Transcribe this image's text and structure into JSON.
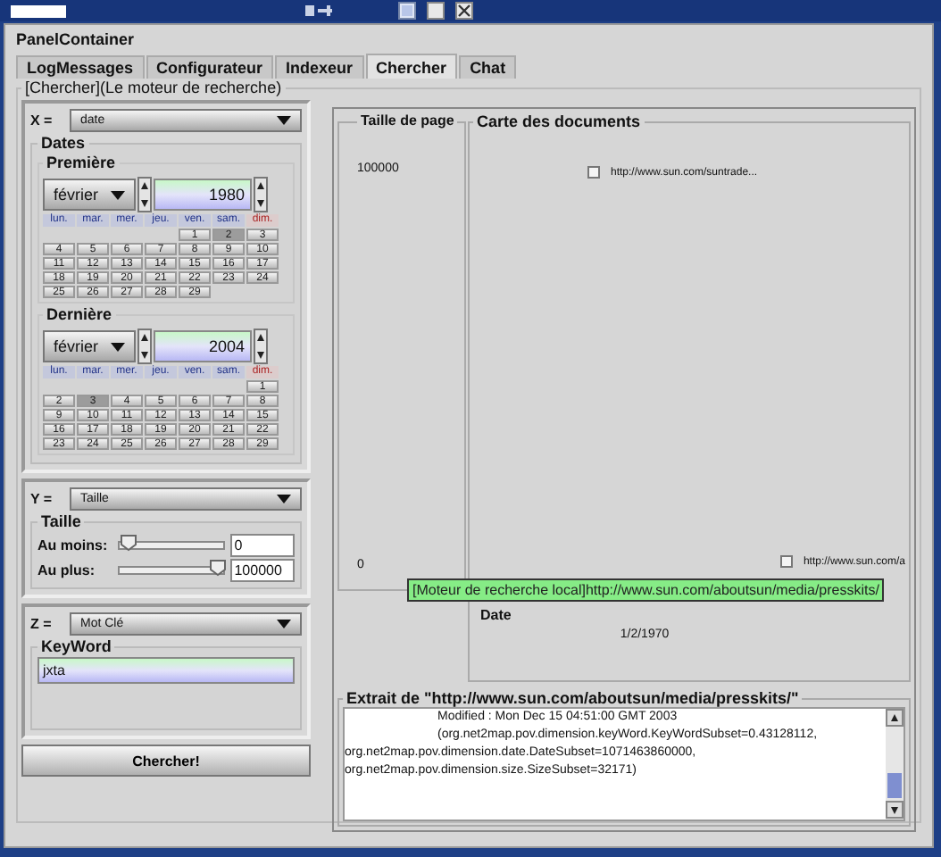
{
  "container_title": "PanelContainer",
  "tabs": [
    {
      "label": "LogMessages",
      "selected": false
    },
    {
      "label": "Configurateur",
      "selected": false
    },
    {
      "label": "Indexeur",
      "selected": false
    },
    {
      "label": "Chercher",
      "selected": true
    },
    {
      "label": "Chat",
      "selected": false
    }
  ],
  "panel_title": "[Chercher](Le moteur de recherche)",
  "x_axis": {
    "label": "X =",
    "value": "date",
    "group": "Dates",
    "calendars": [
      {
        "title": "Première",
        "month": "février",
        "year": "1980",
        "day_headers": [
          "lun.",
          "mar.",
          "mer.",
          "jeu.",
          "ven.",
          "sam.",
          "dim."
        ],
        "weeks": [
          [
            {
              "day": "1",
              "selected": false
            },
            {
              "day": "2",
              "selected": true
            },
            {
              "day": "3",
              "selected": false
            }
          ],
          [
            {
              "day": "4",
              "selected": false
            },
            {
              "day": "5",
              "selected": false
            },
            {
              "day": "6",
              "selected": false
            },
            {
              "day": "7",
              "selected": false
            },
            {
              "day": "8",
              "selected": false
            },
            {
              "day": "9",
              "selected": false
            },
            {
              "day": "10",
              "selected": false
            }
          ],
          [
            {
              "day": "11",
              "selected": false
            },
            {
              "day": "12",
              "selected": false
            },
            {
              "day": "13",
              "selected": false
            },
            {
              "day": "14",
              "selected": false
            },
            {
              "day": "15",
              "selected": false
            },
            {
              "day": "16",
              "selected": false
            },
            {
              "day": "17",
              "selected": false
            }
          ],
          [
            {
              "day": "18",
              "selected": false
            },
            {
              "day": "19",
              "selected": false
            },
            {
              "day": "20",
              "selected": false
            },
            {
              "day": "21",
              "selected": false
            },
            {
              "day": "22",
              "selected": false
            },
            {
              "day": "23",
              "selected": false
            },
            {
              "day": "24",
              "selected": false
            }
          ],
          [
            {
              "day": "25",
              "selected": false
            },
            {
              "day": "26",
              "selected": false
            },
            {
              "day": "27",
              "selected": false
            },
            {
              "day": "28",
              "selected": false
            },
            {
              "day": "29",
              "selected": false
            }
          ]
        ]
      },
      {
        "title": "Dernière",
        "month": "février",
        "year": "2004",
        "day_headers": [
          "lun.",
          "mar.",
          "mer.",
          "jeu.",
          "ven.",
          "sam.",
          "dim."
        ],
        "weeks": [
          [
            {
              "day": "1",
              "selected": false
            }
          ],
          [
            {
              "day": "2",
              "selected": false
            },
            {
              "day": "3",
              "selected": true
            },
            {
              "day": "4",
              "selected": false
            },
            {
              "day": "5",
              "selected": false
            },
            {
              "day": "6",
              "selected": false
            },
            {
              "day": "7",
              "selected": false
            },
            {
              "day": "8",
              "selected": false
            }
          ],
          [
            {
              "day": "9",
              "selected": false
            },
            {
              "day": "10",
              "selected": false
            },
            {
              "day": "11",
              "selected": false
            },
            {
              "day": "12",
              "selected": false
            },
            {
              "day": "13",
              "selected": false
            },
            {
              "day": "14",
              "selected": false
            },
            {
              "day": "15",
              "selected": false
            }
          ],
          [
            {
              "day": "16",
              "selected": false
            },
            {
              "day": "17",
              "selected": false
            },
            {
              "day": "18",
              "selected": false
            },
            {
              "day": "19",
              "selected": false
            },
            {
              "day": "20",
              "selected": false
            },
            {
              "day": "21",
              "selected": false
            },
            {
              "day": "22",
              "selected": false
            }
          ],
          [
            {
              "day": "23",
              "selected": false
            },
            {
              "day": "24",
              "selected": false
            },
            {
              "day": "25",
              "selected": false
            },
            {
              "day": "26",
              "selected": false
            },
            {
              "day": "27",
              "selected": false
            },
            {
              "day": "28",
              "selected": false
            },
            {
              "day": "29",
              "selected": false
            }
          ]
        ]
      }
    ]
  },
  "y_axis": {
    "label": "Y =",
    "value": "Taille",
    "group": "Taille",
    "sliders": [
      {
        "label": "Au moins:",
        "level": 0,
        "value": "0"
      },
      {
        "label": "Au plus:",
        "level": 1,
        "value": "100000"
      }
    ]
  },
  "z_axis": {
    "label": "Z =",
    "value": "Mot Clé",
    "group": "KeyWord",
    "keyword": "jxta"
  },
  "search_button": "Chercher!",
  "results": {
    "y_title": "Taille de page",
    "y_ticks": [
      "100000",
      "0"
    ],
    "map_title": "Carte des documents",
    "documents": [
      {
        "url": "http://www.sun.com/suntrade...",
        "checked": false
      },
      {
        "url": "http://www.sun.com/a",
        "checked": false
      }
    ],
    "x_title": "Date",
    "x_ticks": [
      "1/2/1970"
    ],
    "tooltip": "[Moteur de recherche local]http://www.sun.com/aboutsun/media/presskits/"
  },
  "extract": {
    "title": "Extrait de \"http://www.sun.com/aboutsun/media/presskits/\"",
    "lines": [
      {
        "text": "Modified : Mon Dec 15 04:51:00 GMT 2003",
        "indented": true
      },
      {
        "text": "(org.net2map.pov.dimension.keyWord.KeyWordSubset=0.43128112,",
        "indented": true
      },
      {
        "text": "org.net2map.pov.dimension.date.DateSubset=1071463860000,",
        "indented": false
      },
      {
        "text": "org.net2map.pov.dimension.size.SizeSubset=32171)",
        "indented": false
      }
    ]
  }
}
